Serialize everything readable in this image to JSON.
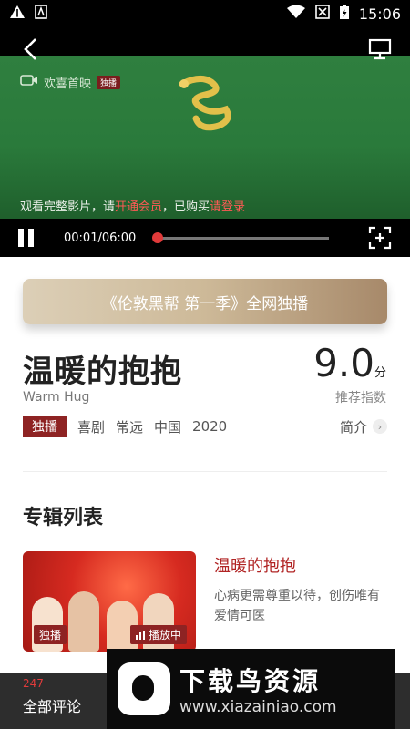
{
  "status_bar": {
    "time": "15:06"
  },
  "video": {
    "brand": "欢喜首映",
    "brand_tag": "独播",
    "prompt_prefix": "观看完整影片，请",
    "prompt_open_member": "开通会员",
    "prompt_mid": "，已购买",
    "prompt_login": "请登录",
    "time_display": "00:01/06:00",
    "progress": 0.0
  },
  "banner": {
    "text": "《伦敦黑帮 第一季》全网独播"
  },
  "show": {
    "title": "温暖的抱抱",
    "subtitle": "Warm Hug",
    "score": "9.0",
    "score_unit": "分",
    "score_label": "推荐指数",
    "badge": "独播",
    "genre": "喜剧",
    "director": "常远",
    "region": "中国",
    "year": "2020",
    "intro": "简介"
  },
  "section": {
    "album_title": "专辑列表"
  },
  "episode": {
    "tag_exclusive": "独播",
    "tag_playing": "播放中",
    "title": "温暖的抱抱",
    "description": "心病更需尊重以待，创伤唯有爱情可医"
  },
  "bottom": {
    "comment_count": "247",
    "all_comments": "全部评论"
  },
  "watermark": {
    "title": "下载鸟资源",
    "url": "www.xiazainiao.com"
  },
  "colors": {
    "accent_red": "#e03a3a",
    "badge_red": "#8e2323",
    "banner_gold": "#cdb998"
  }
}
